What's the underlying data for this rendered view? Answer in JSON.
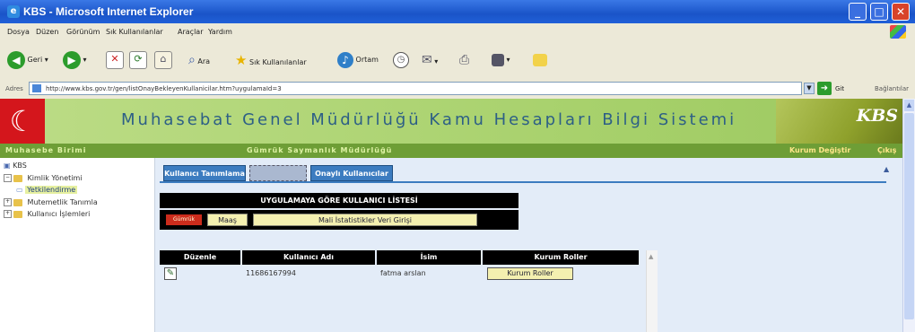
{
  "window": {
    "title": "KBS - Microsoft Internet Explorer",
    "controls": {
      "minimize": "_",
      "maximize": "□",
      "close": "✕"
    }
  },
  "menu": [
    "Dosya",
    "Düzen",
    "Görünüm",
    "Sık Kullanılanlar",
    "Araçlar",
    "Yardım"
  ],
  "toolbar": {
    "back_label": "Geri",
    "search_label": "Ara",
    "favorites_label": "Sık Kullanılanlar",
    "media_label": "Ortam"
  },
  "address": {
    "label": "Adres",
    "url": "http://www.kbs.gov.tr/gen/listOnayBekleyenKullanicilar.htm?uygulamaId=3",
    "go_label": "Git",
    "links_label": "Bağlantılar"
  },
  "site": {
    "flag_glyph": "☾",
    "title": "Muhasebat Genel Müdürlüğü Kamu Hesapları Bilgi Sistemi",
    "logo_text": "KBS",
    "subbar_left": "Muhasebe Birimi",
    "subbar_center": "Gümrük Saymanlık Müdürlüğü",
    "subbar_link1": "Kurum Değiştir",
    "subbar_link2": "Çıkış"
  },
  "tree": {
    "root": "KBS",
    "items": [
      "Kimlik Yönetimi",
      "Yetkilendirme",
      "Mutemetlik Tanımla",
      "Kullanıcı İşlemleri"
    ]
  },
  "tabs": [
    "Kullanıcı Tanımlama",
    "Onaylı Kullanıcılar"
  ],
  "list": {
    "header": "UYGULAMAYA GÖRE KULLANICI LİSTESİ",
    "gumruk": "Gümrük",
    "maas": "Maaş",
    "mali": "Mali İstatistikler Veri Girişi"
  },
  "table": {
    "columns": [
      "Düzenle",
      "Kullanıcı Adı",
      "İsim",
      "Kurum Roller"
    ],
    "rows": [
      {
        "username": "11686167994",
        "name": "fatma arslan",
        "roles_button": "Kurum Roller"
      }
    ]
  },
  "colors": {
    "title_bar": "#1a54c8",
    "banner": "#a6d06a",
    "tab": "#3c7cc0",
    "flag": "#d4161c",
    "header_black": "#000000"
  }
}
